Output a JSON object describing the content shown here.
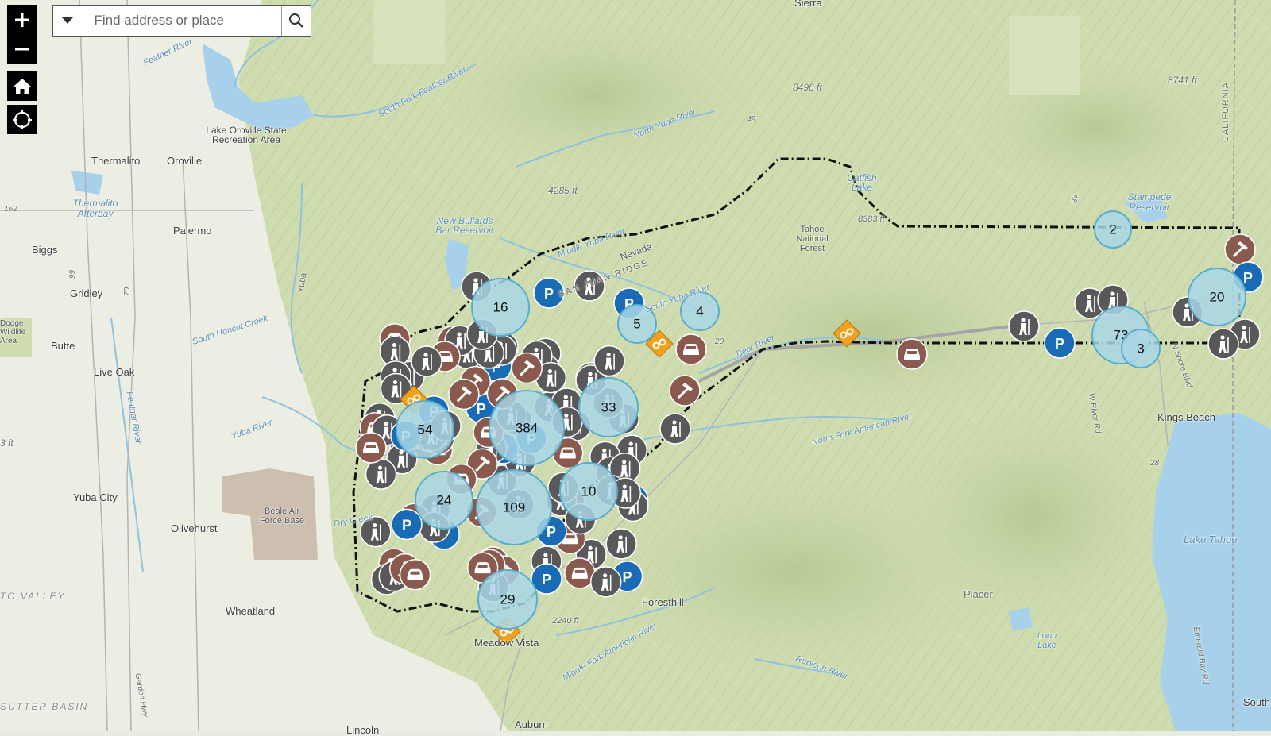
{
  "search": {
    "placeholder": "Find address or place"
  },
  "controls": {
    "zoom_in": "zoom-in-button",
    "zoom_out": "zoom-out-button",
    "home": "home-button",
    "locate": "locate-button"
  },
  "colors": {
    "cluster_fill": "#a9d6e6",
    "cluster_stroke": "#5aaecb",
    "marker_gray": "#59595b",
    "marker_brown": "#8a5a4e",
    "marker_blue": "#1a6bb6",
    "marker_orange": "#f0a21e",
    "boundary": "#111111",
    "terrain": "#cfdcb0"
  },
  "places": [
    {
      "name": "Sierra",
      "type": "town"
    },
    {
      "name": "Feather River",
      "type": "water"
    },
    {
      "name": "Lake Oroville State Recreation Area",
      "type": "park"
    },
    {
      "name": "South Fork Feather River",
      "type": "water"
    },
    {
      "name": "North Yuba River",
      "type": "water"
    },
    {
      "name": "8496 ft",
      "type": "peak"
    },
    {
      "name": "49",
      "type": "road"
    },
    {
      "name": "8741 ft",
      "type": "peak"
    },
    {
      "name": "CALIFORNIA",
      "type": "state"
    },
    {
      "name": "Thermalito",
      "type": "town"
    },
    {
      "name": "Oroville",
      "type": "town"
    },
    {
      "name": "4285 ft",
      "type": "peak"
    },
    {
      "name": "Catfish Lake",
      "type": "water"
    },
    {
      "name": "8383 ft",
      "type": "peak"
    },
    {
      "name": "Stampede Reservoir",
      "type": "water"
    },
    {
      "name": "89",
      "type": "road"
    },
    {
      "name": "162",
      "type": "road"
    },
    {
      "name": "Thermalito Afterbay",
      "type": "water"
    },
    {
      "name": "New Bullards Bar Reservoir",
      "type": "water"
    },
    {
      "name": "Tahoe National Forest",
      "type": "park"
    },
    {
      "name": "Palermo",
      "type": "town"
    },
    {
      "name": "Middle Yuba River",
      "type": "water"
    },
    {
      "name": "Nevada",
      "type": "town"
    },
    {
      "name": "Biggs",
      "type": "town"
    },
    {
      "name": "SAN JUAN RIDGE",
      "type": "ridge"
    },
    {
      "name": "Gridley",
      "type": "town"
    },
    {
      "name": "99",
      "type": "road"
    },
    {
      "name": "70",
      "type": "road"
    },
    {
      "name": "Yuba",
      "type": "water"
    },
    {
      "name": "South Yuba River",
      "type": "water"
    },
    {
      "name": "Dodge Wildlife Area",
      "type": "park"
    },
    {
      "name": "South Honcut Creek",
      "type": "water"
    },
    {
      "name": "Butte",
      "type": "town"
    },
    {
      "name": "20",
      "type": "road"
    },
    {
      "name": "Bear River",
      "type": "water"
    },
    {
      "name": "N Shore Blvd",
      "type": "road"
    },
    {
      "name": "Live Oak",
      "type": "town"
    },
    {
      "name": "Feather River",
      "type": "water"
    },
    {
      "name": "W River Rd",
      "type": "road"
    },
    {
      "name": "Kings Beach",
      "type": "town"
    },
    {
      "name": "Yuba River",
      "type": "water"
    },
    {
      "name": "North Fork American River",
      "type": "water"
    },
    {
      "name": "Yuba City",
      "type": "town"
    },
    {
      "name": "Beale Air Force Base",
      "type": "base"
    },
    {
      "name": "Olivehurst",
      "type": "town"
    },
    {
      "name": "Dry Creek",
      "type": "water"
    },
    {
      "name": "28",
      "type": "road"
    },
    {
      "name": "Lake Tahoe",
      "type": "water"
    },
    {
      "name": "Foresthill",
      "type": "town"
    },
    {
      "name": "Placer",
      "type": "town"
    },
    {
      "name": "TO VALLEY",
      "type": "region"
    },
    {
      "name": "Wheatland",
      "type": "town"
    },
    {
      "name": "2240 ft",
      "type": "peak"
    },
    {
      "name": "Meadow Vista",
      "type": "town"
    },
    {
      "name": "Loon Lake",
      "type": "water"
    },
    {
      "name": "Middle Fork American River",
      "type": "water"
    },
    {
      "name": "Rubicon River",
      "type": "water"
    },
    {
      "name": "SUTTER BASIN",
      "type": "region"
    },
    {
      "name": "Garden Hwy",
      "type": "road"
    },
    {
      "name": "Emerald Bay Rd",
      "type": "road"
    },
    {
      "name": "Auburn",
      "type": "town"
    },
    {
      "name": "Lincoln",
      "type": "town"
    },
    {
      "name": "South Lake Tahoe",
      "type": "town"
    },
    {
      "name": "3 ft",
      "type": "peak"
    }
  ],
  "clusters": [
    {
      "count": "16",
      "type": "cluster"
    },
    {
      "count": "5",
      "type": "cluster"
    },
    {
      "count": "4",
      "type": "cluster"
    },
    {
      "count": "384",
      "type": "cluster"
    },
    {
      "count": "33",
      "type": "cluster"
    },
    {
      "count": "54",
      "type": "cluster"
    },
    {
      "count": "24",
      "type": "cluster"
    },
    {
      "count": "109",
      "type": "cluster"
    },
    {
      "count": "10",
      "type": "cluster"
    },
    {
      "count": "29",
      "type": "cluster"
    },
    {
      "count": "2",
      "type": "cluster"
    },
    {
      "count": "20",
      "type": "cluster"
    },
    {
      "count": "73",
      "type": "cluster"
    },
    {
      "count": "3",
      "type": "cluster"
    }
  ]
}
